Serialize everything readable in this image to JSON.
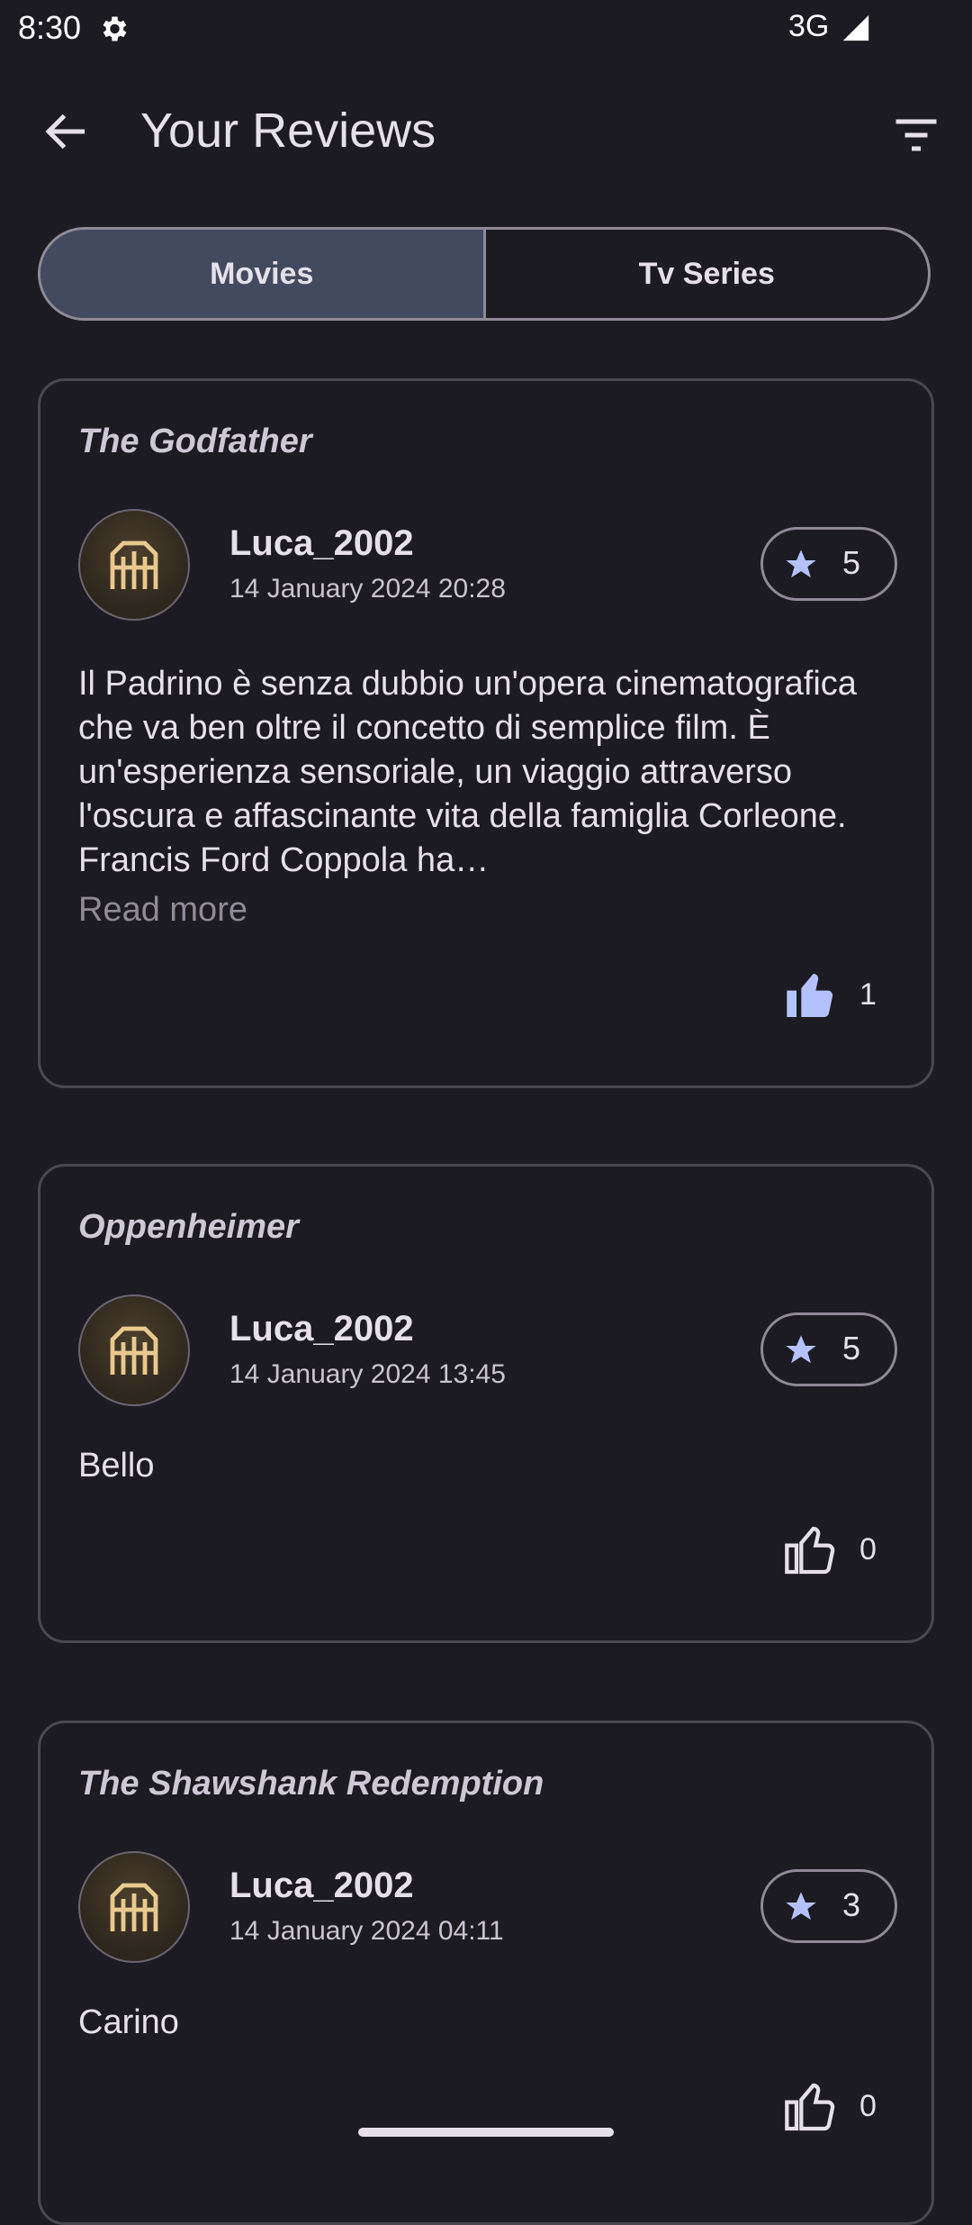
{
  "status_bar": {
    "time": "8:30",
    "network": "3G",
    "icons": [
      "gear-icon",
      "signal-icon"
    ]
  },
  "app_bar": {
    "title": "Your Reviews",
    "back_icon": "arrow-back-icon",
    "filter_icon": "filter-icon"
  },
  "tabs": [
    {
      "label": "Movies",
      "selected": true
    },
    {
      "label": "Tv Series",
      "selected": false
    }
  ],
  "reviews": [
    {
      "title": "The Godfather",
      "user": "Luca_2002",
      "date": "14 January 2024 20:28",
      "rating": "5",
      "text": "Il Padrino è senza dubbio un'opera cinematografica che va ben oltre il concetto di semplice film. È un'esperienza sensoriale, un viaggio attraverso l'oscura e affascinante vita della famiglia Corleone. Francis Ford Coppola ha…",
      "read_more": "Read more",
      "likes": "1",
      "liked": true
    },
    {
      "title": "Oppenheimer",
      "user": "Luca_2002",
      "date": "14 January 2024 13:45",
      "rating": "5",
      "text": "Bello",
      "likes": "0",
      "liked": false
    },
    {
      "title": "The Shawshank Redemption",
      "user": "Luca_2002",
      "date": "14 January 2024 04:11",
      "rating": "3",
      "text": "Carino",
      "likes": "0",
      "liked": false
    }
  ],
  "colors": {
    "background": "#1c1b21",
    "accent": "#b4c3ff",
    "segment_selected": "#434a60",
    "outline": "#8f8a96"
  }
}
